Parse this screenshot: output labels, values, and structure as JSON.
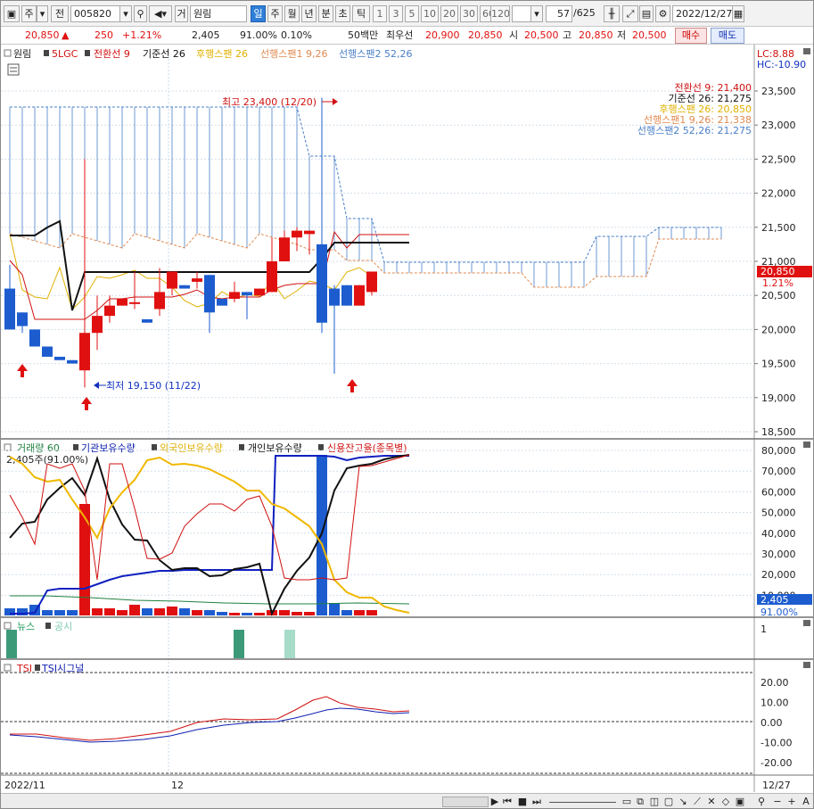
{
  "toolbar": {
    "market": "주",
    "prev": "전",
    "code": "005820",
    "type_prefix": "거",
    "stock_name": "원림",
    "period_buttons": [
      "일",
      "주",
      "월",
      "년",
      "분",
      "초",
      "틱"
    ],
    "period_selected": "일",
    "minute_buttons": [
      "1",
      "3",
      "5",
      "10",
      "20",
      "30",
      "60",
      "120"
    ],
    "count": "57",
    "total": "/625",
    "date": "2022/12/27"
  },
  "quote": {
    "price": "20,850",
    "change_arrow": "▲",
    "change": "250",
    "change_pct": "+1.21%",
    "volume": "2,405",
    "vol_ratio": "91.00%",
    "turnover": "0.10%",
    "unit": "50백만",
    "best_label": "최우선",
    "best_ask": "20,900",
    "best_bid": "20,850",
    "open_label": "시",
    "open": "20,500",
    "high_label": "고",
    "high": "20,850",
    "low_label": "저",
    "low": "20,500",
    "buy": "매수",
    "sell": "매도"
  },
  "price_panel": {
    "legend": [
      "원림",
      "5LGC",
      "전환선 9",
      "기준선 26",
      "후행스팬 26",
      "선행스팬1 9,26",
      "선행스팬2 52,26"
    ],
    "lc": "LC:8.88",
    "hc": "HC:-10.90",
    "values": [
      "전환선 9: 21,400",
      "기준선 26: 21,275",
      "후행스팬 26: 20,850",
      "선행스팬1 9,26: 21,338",
      "선행스팬2 52,26: 21,275"
    ],
    "high_note": "최고 23,400 (12/20)",
    "low_note": "최저 19,150 (11/22)",
    "current_tag": "20,850",
    "current_pct": "1.21%",
    "y_ticks": [
      "23,500",
      "23,000",
      "22,500",
      "22,000",
      "21,500",
      "21,000",
      "20,500",
      "20,000",
      "19,500",
      "19,000",
      "18,500"
    ]
  },
  "volume_panel": {
    "legend": [
      "거래량 60",
      "기관보유수량",
      "외국인보유수량",
      "개인보유수량",
      "신용잔고율(종목별)"
    ],
    "info": "2,405주(91.00%)",
    "tag_vol": "2,405",
    "tag_pct": "91.00%",
    "y_ticks": [
      "80,000",
      "70,000",
      "60,000",
      "50,000",
      "40,000",
      "30,000",
      "20,000",
      "10,000"
    ]
  },
  "news_panel": {
    "legend": [
      "뉴스",
      "공시"
    ],
    "y_tick": "1"
  },
  "tsi_panel": {
    "legend": [
      "TSI",
      "TSI시그널"
    ],
    "y_ticks": [
      "20.00",
      "10.00",
      "0.00",
      "-10.00",
      "-20.00"
    ]
  },
  "xaxis": {
    "labels": [
      "2022/11",
      "12"
    ],
    "last": "12/27"
  },
  "chart_data": {
    "type": "candlestick",
    "dates": [
      "11/16",
      "11/17",
      "11/18",
      "11/21",
      "11/22",
      "11/23",
      "11/24",
      "11/25",
      "11/28",
      "11/29",
      "11/30",
      "12/01",
      "12/02",
      "12/05",
      "12/06",
      "12/07",
      "12/08",
      "12/09",
      "12/12",
      "12/13",
      "12/14",
      "12/15",
      "12/16",
      "12/19",
      "12/20",
      "12/21",
      "12/22",
      "12/23",
      "12/26",
      "12/27"
    ],
    "ohlc": [
      [
        20600,
        20950,
        20000,
        20000
      ],
      [
        20250,
        20250,
        19950,
        20050
      ],
      [
        20000,
        20000,
        19750,
        19750
      ],
      [
        19750,
        19750,
        19600,
        19600
      ],
      [
        19600,
        19600,
        19550,
        19550
      ],
      [
        19550,
        19550,
        19500,
        19500
      ],
      [
        19400,
        22500,
        19150,
        19950
      ],
      [
        19950,
        20500,
        19700,
        20200
      ],
      [
        20200,
        20500,
        20100,
        20350
      ],
      [
        20350,
        20450,
        20350,
        20450
      ],
      [
        20400,
        20850,
        20300,
        20400
      ],
      [
        20150,
        20150,
        20100,
        20100
      ],
      [
        20300,
        20900,
        20200,
        20550
      ],
      [
        20600,
        20850,
        20500,
        20850
      ],
      [
        20650,
        20650,
        20600,
        20600
      ],
      [
        20700,
        20850,
        20600,
        20750
      ],
      [
        20800,
        20800,
        19950,
        20250
      ],
      [
        20450,
        20450,
        20350,
        20350
      ],
      [
        20450,
        20700,
        20400,
        20550
      ],
      [
        20550,
        20550,
        20150,
        20500
      ],
      [
        20500,
        20600,
        20500,
        20600
      ],
      [
        20550,
        21350,
        20550,
        21000
      ],
      [
        21000,
        21450,
        21100,
        21350
      ],
      [
        21350,
        21500,
        21150,
        21450
      ],
      [
        21400,
        21450,
        21100,
        21450
      ],
      [
        21250,
        23400,
        19950,
        20100
      ],
      [
        20600,
        20650,
        19350,
        20350
      ],
      [
        20650,
        20650,
        20350,
        20350
      ],
      [
        20350,
        20650,
        20500,
        20650
      ],
      [
        20550,
        20850,
        20500,
        20850
      ]
    ],
    "ylim": [
      18500,
      23500
    ],
    "high": {
      "date": "12/20",
      "value": 23400
    },
    "low": {
      "date": "11/22",
      "value": 19150
    },
    "current": 20850
  }
}
